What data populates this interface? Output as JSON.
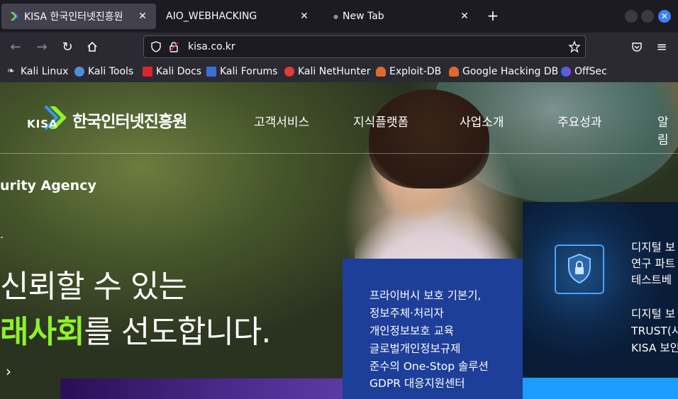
{
  "browser": {
    "tabs": [
      {
        "title": "KISA 한국인터넷진흥원",
        "active": true
      },
      {
        "title": "AIO_WEBHACKING",
        "active": false
      },
      {
        "title": "New Tab",
        "active": false
      }
    ],
    "url": "kisa.co.kr",
    "bookmarks": [
      "Kali Linux",
      "Kali Tools",
      "Kali Docs",
      "Kali Forums",
      "Kali NetHunter",
      "Exploit-DB",
      "Google Hacking DB",
      "OffSec"
    ],
    "bookmark_colors": [
      "#dddddd",
      "#4a90d9",
      "#d9262b",
      "#3b6fd8",
      "#e23b3b",
      "#e06a2a",
      "#e06a2a",
      "#2f6fe0"
    ]
  },
  "site": {
    "logo_mark": "KISA",
    "logo_name": "한국인터넷진흥원",
    "nav": [
      "고객서비스",
      "지식플랫폼",
      "사업소개",
      "주요성과",
      "알림"
    ],
    "hero_sub": "urity Agency",
    "hero_dot": ".",
    "hero_line1": "신뢰할 수 있는",
    "hero_line2_accent": "래사회",
    "hero_line2_rest": "를 선도합니다.",
    "hero_arrow": "›",
    "card_blue": [
      "프라이버시 보호 기본기,",
      "정보주체·처리자",
      "개인정보보호 교육",
      "글로벌개인정보규제",
      "준수의 One-Stop 솔루션",
      "GDPR 대응지원센터"
    ],
    "card_dark": [
      "디지털 보",
      "연구 파트",
      "테스트베",
      "디지털 보",
      "TRUST(사",
      "KISA 보인"
    ],
    "accent_color": "#8cf32c"
  }
}
